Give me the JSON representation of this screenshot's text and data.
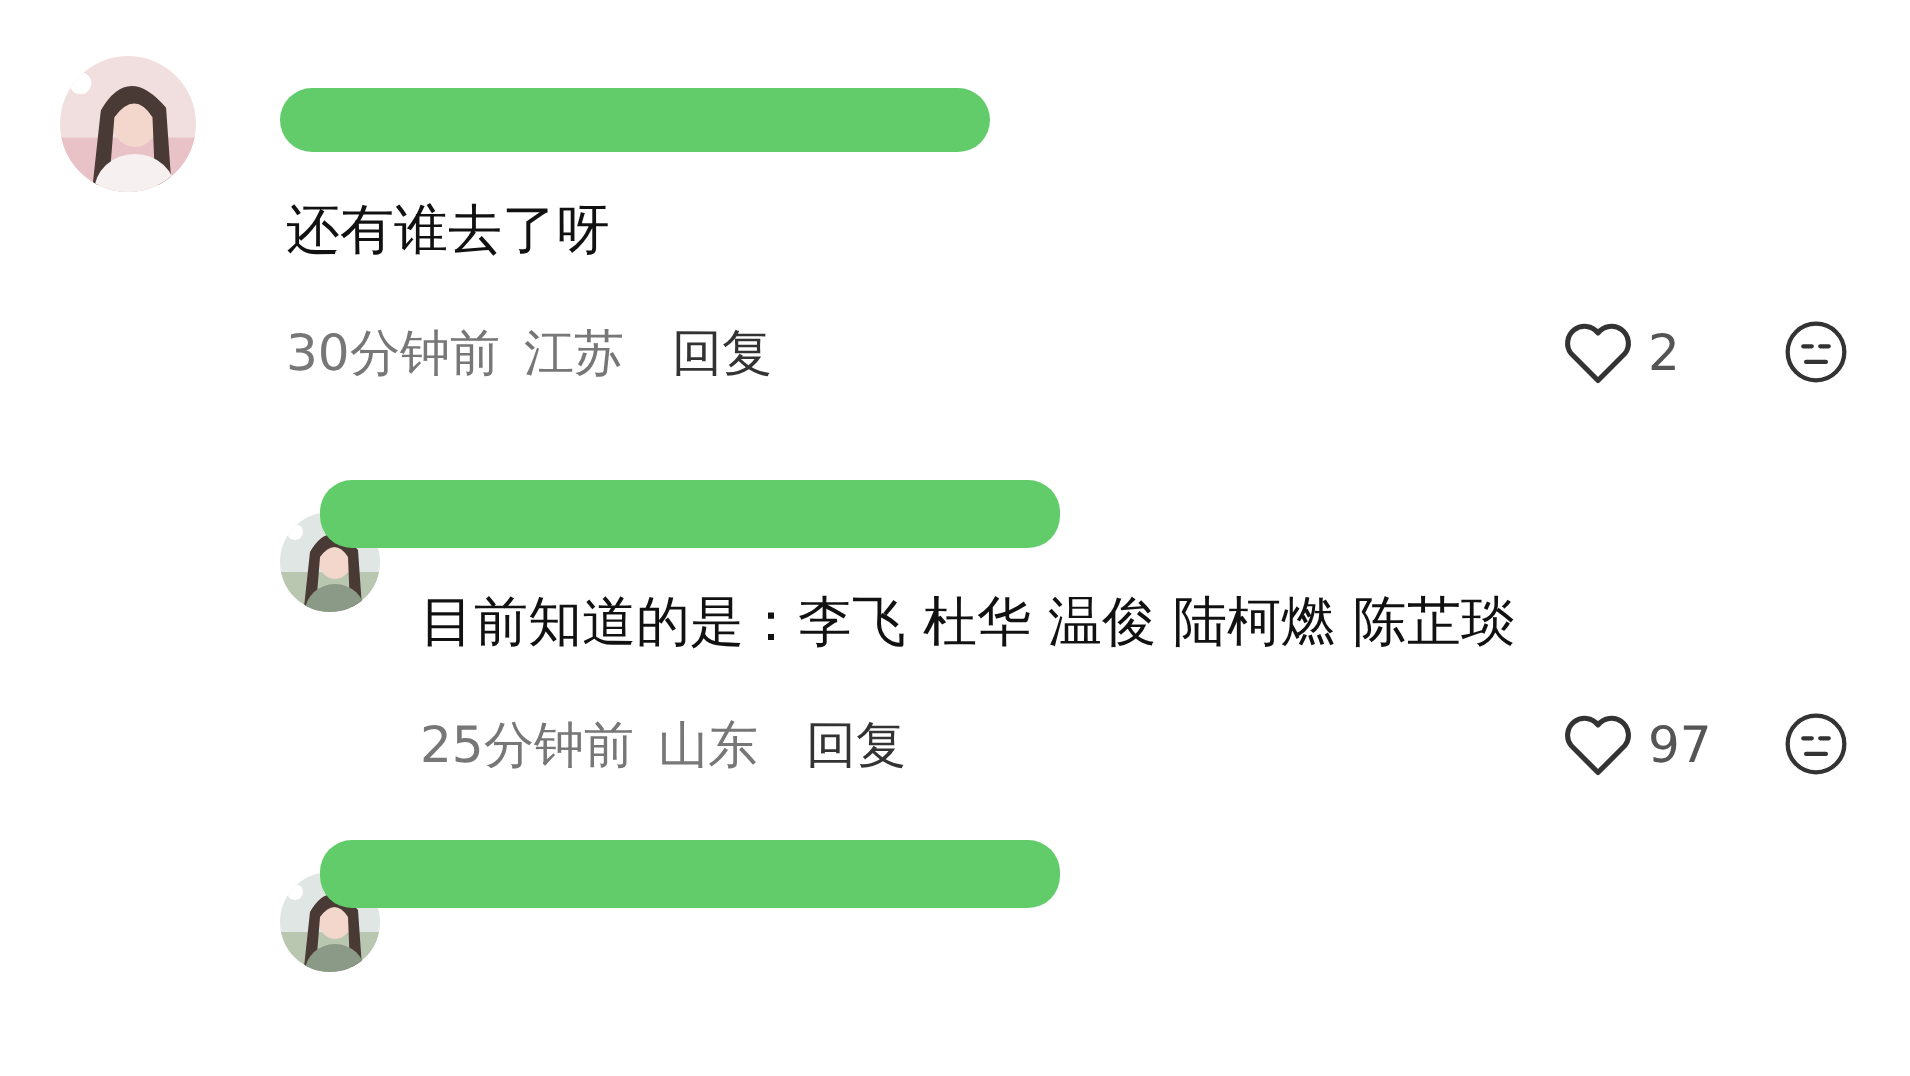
{
  "comments": [
    {
      "kind": "comment",
      "text": "还有谁去了呀",
      "time": "30分钟前",
      "location": "江苏",
      "reply": "回复",
      "likes": "2"
    },
    {
      "kind": "reply",
      "text": "目前知道的是：李飞 杜华 温俊 陆柯燃 陈芷琰",
      "time": "25分钟前",
      "location": "山东",
      "reply": "回复",
      "likes": "97"
    },
    {
      "kind": "reply"
    }
  ]
}
